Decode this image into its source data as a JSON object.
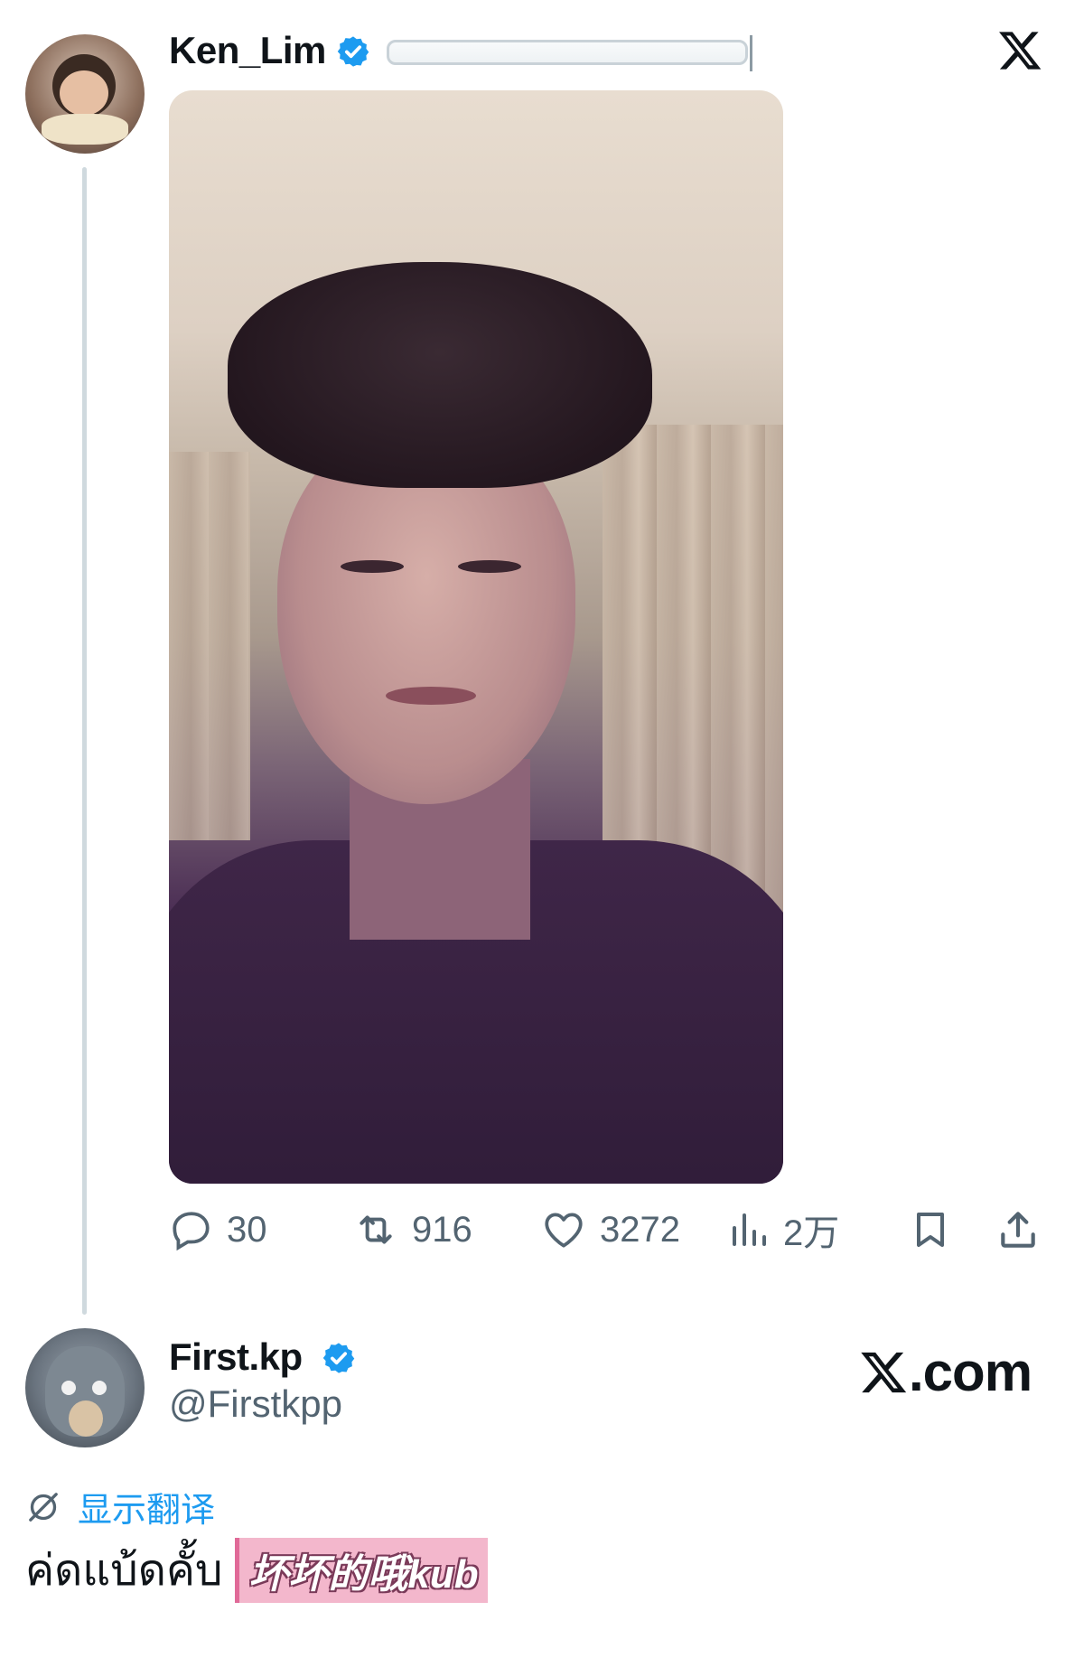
{
  "tweet1": {
    "display_name": "Ken_Lim",
    "verified_icon": "verified-badge-icon",
    "brand_icon": "x-logo-icon",
    "media": {
      "sound_icon": "speaker-icon"
    },
    "actions": {
      "replies": "30",
      "retweets": "916",
      "likes": "3272",
      "views": "2万"
    }
  },
  "tweet2": {
    "display_name": "First.kp",
    "handle": "@Firstkpp",
    "brand_text": ".com",
    "translate_label": "显示翻译",
    "text": "ค่ดแบ้ดคั้บ",
    "caption": "坏坏的哦kub"
  },
  "colors": {
    "accent": "#1d9bf0",
    "muted": "#536471",
    "text": "#0f1419",
    "thread_line": "#cfd9de",
    "caption_bg": "#f3b7cc"
  }
}
